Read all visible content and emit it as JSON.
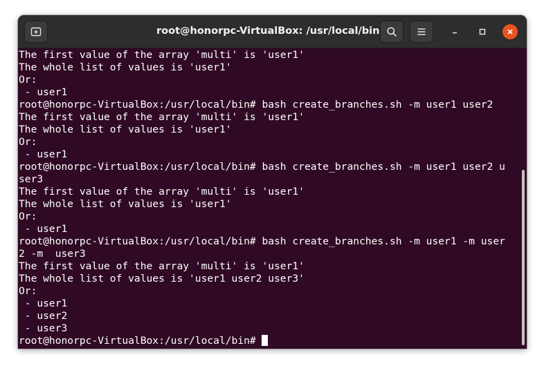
{
  "window": {
    "title": "root@honorpc-VirtualBox: /usr/local/bin",
    "accent_close": "#e95420",
    "terminal_background": "#300a24"
  },
  "titlebar": {
    "new_tab_icon": "new-tab-icon",
    "search_icon": "search-icon",
    "menu_icon": "hamburger-menu-icon",
    "minimize_icon": "minimize-icon",
    "maximize_icon": "maximize-icon",
    "close_icon": "close-icon"
  },
  "terminal": {
    "lines": [
      "The first value of the array 'multi' is 'user1'",
      "The whole list of values is 'user1'",
      "Or:",
      " - user1",
      "root@honorpc-VirtualBox:/usr/local/bin# bash create_branches.sh -m user1 user2",
      "The first value of the array 'multi' is 'user1'",
      "The whole list of values is 'user1'",
      "Or:",
      " - user1",
      "root@honorpc-VirtualBox:/usr/local/bin# bash create_branches.sh -m user1 user2 u",
      "ser3",
      "The first value of the array 'multi' is 'user1'",
      "The whole list of values is 'user1'",
      "Or:",
      " - user1",
      "root@honorpc-VirtualBox:/usr/local/bin# bash create_branches.sh -m user1 -m user",
      "2 -m  user3",
      "The first value of the array 'multi' is 'user1'",
      "The whole list of values is 'user1 user2 user3'",
      "Or:",
      " - user1",
      " - user2",
      " - user3"
    ],
    "prompt": "root@honorpc-VirtualBox:/usr/local/bin# "
  }
}
